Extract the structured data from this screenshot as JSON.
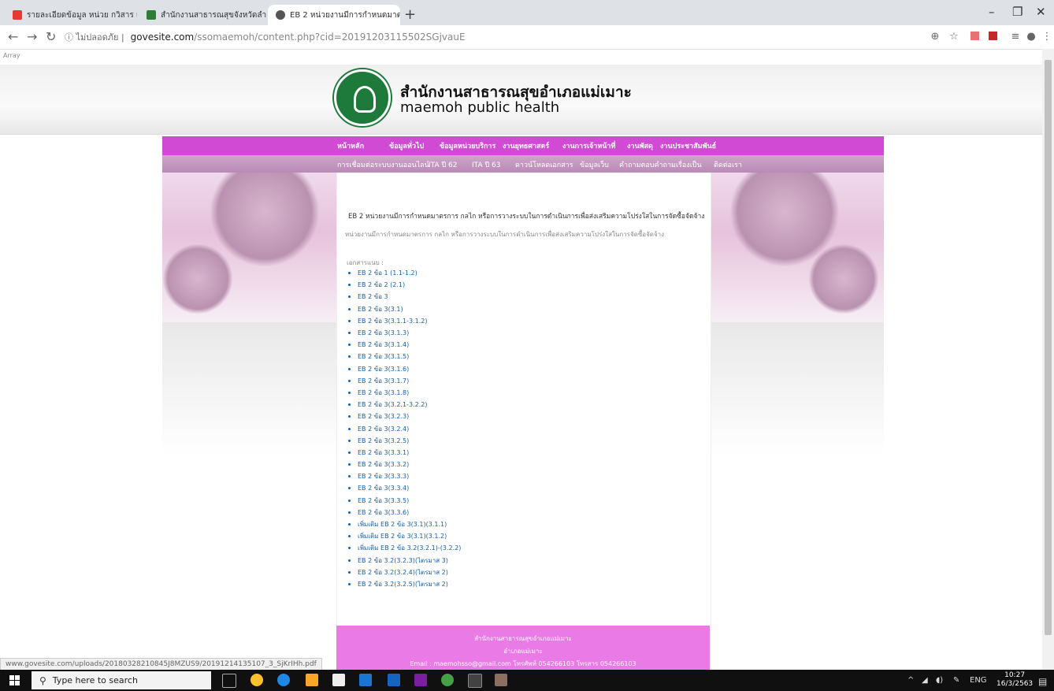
{
  "browser": {
    "tabs": [
      {
        "title": "รายละเอียดข้อมูล หน่วย กวิสาร และ..."
      },
      {
        "title": "สำนักงานสาธารณสุขจังหวัดลำปาง - ..."
      },
      {
        "title": "EB 2 หน่วยงานมีการกำหนดมาตรการ"
      }
    ],
    "security_label": "ไม่ปลอดภัย",
    "url_host": "govesite.com",
    "url_path": "/ssomaemoh/content.php?cid=20191203115502SGjvauE",
    "page_debug_text": "Array",
    "status_url": "www.govesite.com/uploads/20180328210845J8MZUS9/20191214135107_3_SjKrIHh.pdf"
  },
  "site": {
    "title_th": "สำนักงานสาธารณสุขอำเภอแม่เมาะ",
    "title_en": "maemoh public health",
    "menu_primary": [
      "หน้าหลัก",
      "ข้อมูลทั่วไป",
      "ข้อมูลหน่วยบริการ",
      "งานยุทธศาสตร์",
      "งานการเจ้าหน้าที่",
      "งานพัสดุ",
      "งานประชาสัมพันธ์"
    ],
    "menu_secondary": [
      "การเชื่อมต่อระบบงานออนไลน์",
      "ITA ปี 62",
      "ITA ปี 63",
      "ดาวน์โหลดเอกสาร",
      "ข้อมูลเว็บ",
      "คำถามตอบคำถามเรื่องเป็น",
      "ติดต่อเรา"
    ]
  },
  "content": {
    "title": "EB 2 หน่วยงานมีการกำหนดมาตรการ กลไก หรือการวางระบบในการดำเนินการเพื่อส่งเสริมความโปร่งใสในการจัดซื้อจัดจ้าง",
    "description": "หน่วยงานมีการกำหนดมาตรการ กลไก หรือการวางระบบในการดำเนินการเพื่อส่งเสริมความโปร่งใสในการจัดซื้อจัดจ้าง",
    "documents_label": "เอกสารแนบ :",
    "documents": [
      "EB 2 ข้อ 1 (1.1-1.2)",
      "EB 2 ข้อ 2 (2.1)",
      "EB 2 ข้อ 3",
      "EB 2 ข้อ 3(3.1)",
      "EB 2 ข้อ 3(3.1.1-3.1.2)",
      "EB 2 ข้อ 3(3.1.3)",
      "EB 2 ข้อ 3(3.1.4)",
      "EB 2 ข้อ 3(3.1.5)",
      "EB 2 ข้อ 3(3.1.6)",
      "EB 2 ข้อ 3(3.1.7)",
      "EB 2 ข้อ 3(3.1.8)",
      "EB 2 ข้อ 3(3.2.1-3.2.2)",
      "EB 2 ข้อ 3(3.2.3)",
      "EB 2 ข้อ 3(3.2.4)",
      "EB 2 ข้อ 3(3.2.5)",
      "EB 2 ข้อ 3(3.3.1)",
      "EB 2 ข้อ 3(3.3.2)",
      "EB 2 ข้อ 3(3.3.3)",
      "EB 2 ข้อ 3(3.3.4)",
      "EB 2 ข้อ 3(3.3.5)",
      "EB 2 ข้อ 3(3.3.6)",
      "เพิ่มเติม EB 2 ข้อ 3(3.1)(3.1.1)",
      "เพิ่มเติม EB 2 ข้อ 3(3.1)(3.1.2)",
      "เพิ่มเติม EB 2 ข้อ 3.2(3.2.1)-(3.2.2)",
      "EB 2 ข้อ 3.2(3.2.3)(ไตรมาส 3)",
      "EB 2 ข้อ 3.2(3.2.4)(ไตรมาส 2)",
      "EB 2 ข้อ 3.2(3.2.5)(ไตรมาส 2)"
    ]
  },
  "footer": {
    "org": "สำนักงานสาธารณสุขอำเภอแม่เมาะ",
    "district": "อำเภอแม่เมาะ",
    "contact": "Email : maemohsso@gmail.com โทรศัพท์ 054266103 โทรสาร 054266103"
  },
  "taskbar": {
    "search_placeholder": "Type here to search",
    "lang": "ENG",
    "time": "10:27",
    "date": "16/3/2563"
  },
  "colors": {
    "menu_primary": "#d04ad4",
    "footer": "#ea7ae5",
    "link": "#1a5fa8"
  }
}
